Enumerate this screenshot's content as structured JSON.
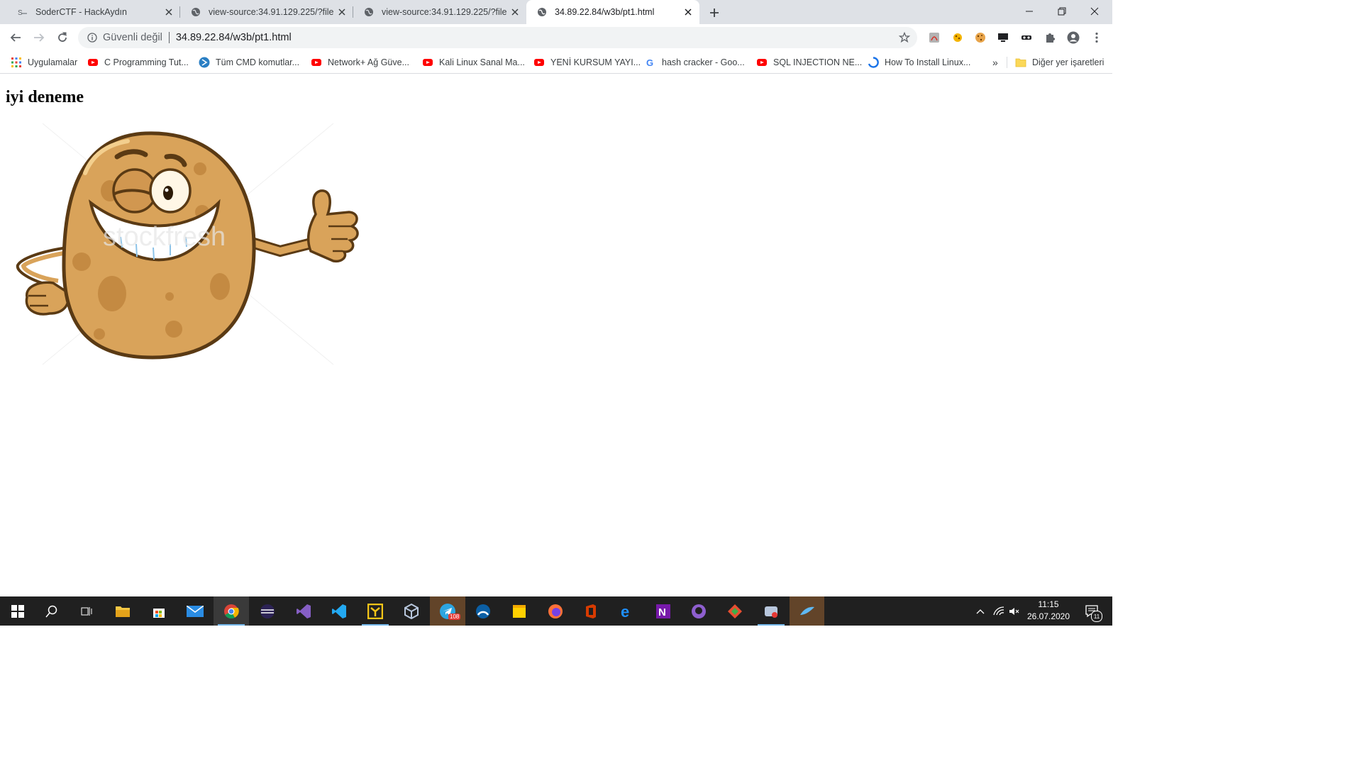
{
  "browser": {
    "tabs": [
      {
        "title": "SoderCTF - HackAydın",
        "favicon": "site-favicon",
        "active": false
      },
      {
        "title": "view-source:34.91.129.225/?file=",
        "favicon": "globe-icon",
        "active": false
      },
      {
        "title": "view-source:34.91.129.225/?file=",
        "favicon": "globe-icon",
        "active": false
      },
      {
        "title": "34.89.22.84/w3b/pt1.html",
        "favicon": "globe-icon",
        "active": true
      }
    ],
    "omnibox": {
      "security_label": "Güvenli değil",
      "url": "34.89.22.84/w3b/pt1.html"
    },
    "bookmarks": [
      {
        "label": "Uygulamalar",
        "icon": "apps-grid-icon"
      },
      {
        "label": "C Programming Tut...",
        "icon": "youtube-icon"
      },
      {
        "label": "Tüm CMD komutlar...",
        "icon": "site-icon"
      },
      {
        "label": "Network+ Ağ Güve...",
        "icon": "youtube-icon"
      },
      {
        "label": "Kali Linux Sanal Ma...",
        "icon": "youtube-icon"
      },
      {
        "label": "YENİ KURSUM YAYI...",
        "icon": "youtube-icon"
      },
      {
        "label": "hash cracker - Goo...",
        "icon": "google-icon"
      },
      {
        "label": "SQL INJECTION NE...",
        "icon": "youtube-icon"
      },
      {
        "label": "How To Install Linux...",
        "icon": "site-icon"
      }
    ],
    "bookmarks_overflow": "»",
    "other_bookmarks": "Diğer yer işaretleri"
  },
  "page": {
    "heading": "iyi deneme",
    "image_watermark": "stockfresh"
  },
  "taskbar": {
    "time": "11:15",
    "date": "26.07.2020",
    "notification_count": "11",
    "telegram_badge": "108"
  },
  "colors": {
    "tabstrip": "#dee1e6",
    "taskbar": "#202020",
    "potato_body": "#d9a35a",
    "potato_outline": "#5a3a14"
  }
}
